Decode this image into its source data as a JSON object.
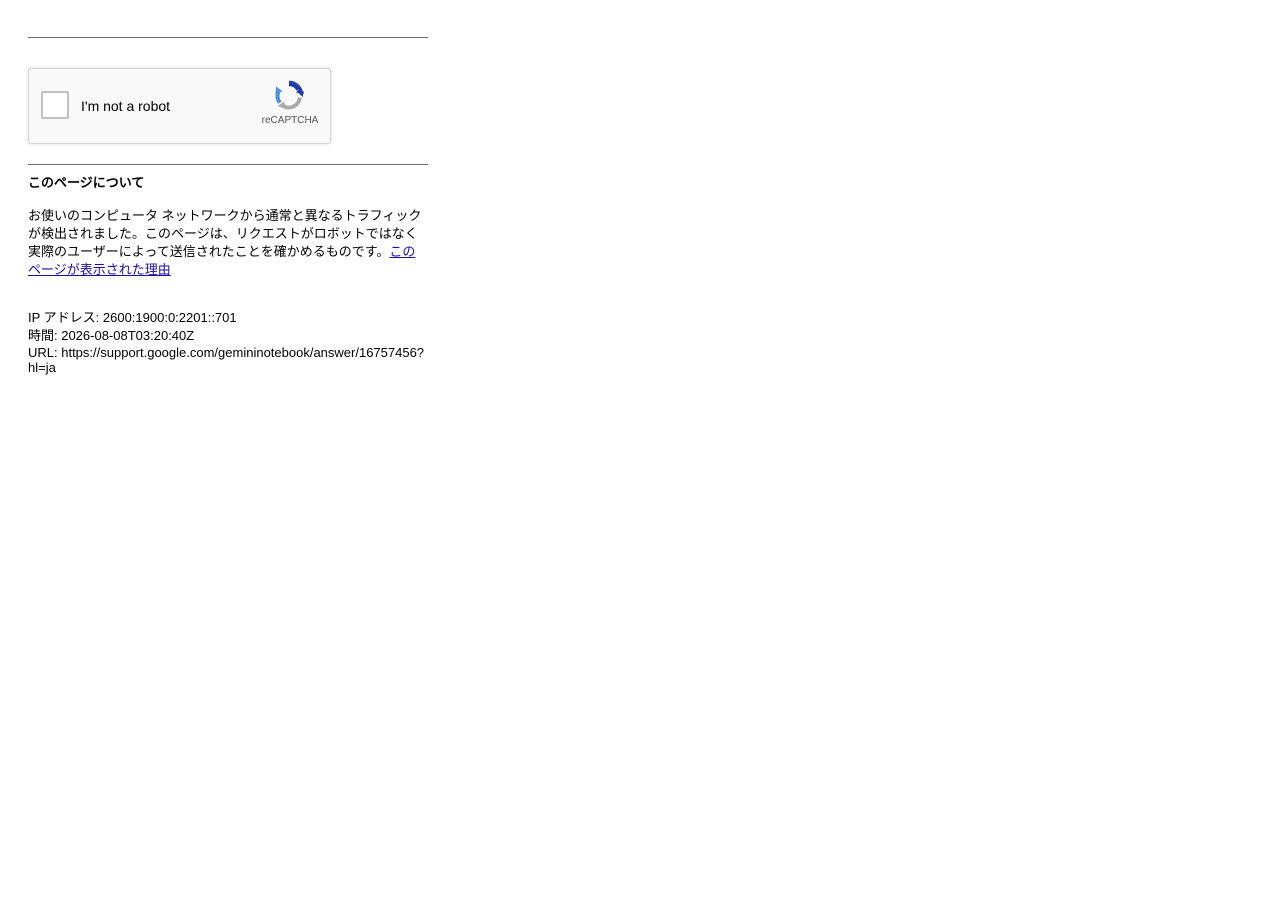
{
  "captcha": {
    "label": "I'm not a robot",
    "brand": "reCAPTCHA"
  },
  "about": {
    "heading": "このページについて",
    "text": "お使いのコンピュータ ネットワークから通常と異なるトラフィックが検出されました。このページは、リクエストがロボットではなく実際のユーザーによって送信されたことを確かめるものです。",
    "link_text": "このページが表示された理由"
  },
  "info": {
    "ip": "IP アドレス: 2600:1900:0:2201::701",
    "time": "時間: 2026-08-08T03:20:40Z",
    "url": "URL: https://support.google.com/gemininotebook/answer/16757456?hl=ja"
  },
  "colors": {
    "link": "#1a0dab",
    "rule": "#6f6f6f",
    "captcha_bg": "#f9f9f9",
    "logo_blue": "#1c3aa9",
    "logo_light_blue": "#4a90e2",
    "logo_gray": "#aaaaaa"
  }
}
